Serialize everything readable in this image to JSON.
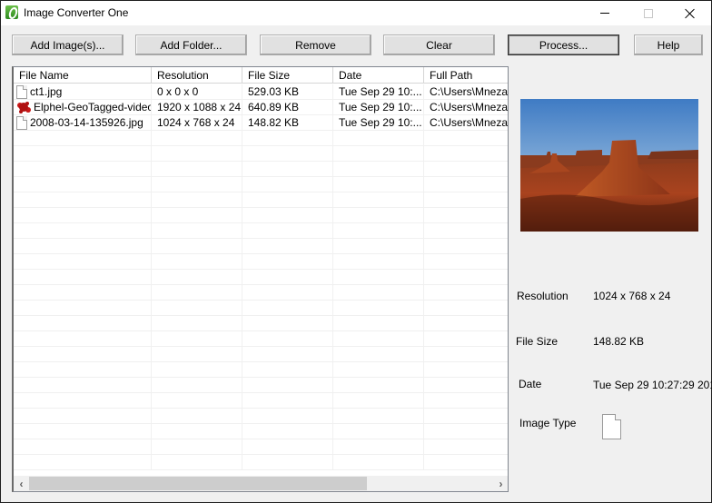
{
  "window": {
    "title": "Image Converter One",
    "controls": {
      "minimize": "minimize-icon",
      "maximize": "maximize-icon",
      "close": "close-icon"
    }
  },
  "toolbar": {
    "add_images": "Add Image(s)...",
    "add_folder": "Add Folder...",
    "remove": "Remove",
    "clear": "Clear",
    "process": "Process...",
    "help": "Help"
  },
  "file_list": {
    "columns": [
      "File Name",
      "Resolution",
      "File Size",
      "Date",
      "Full Path"
    ],
    "rows": [
      {
        "icon": "document-icon",
        "name": "ct1.jpg",
        "resolution": "0 x 0 x 0",
        "size": "529.03 KB",
        "date": "Tue Sep 29 10:...",
        "path": "C:\\Users\\Mnezau\\"
      },
      {
        "icon": "red-splat-icon",
        "name": "Elphel-GeoTagged-video...",
        "resolution": "1920 x 1088 x 24",
        "size": "640.89 KB",
        "date": "Tue Sep 29 10:...",
        "path": "C:\\Users\\Mnezau\\"
      },
      {
        "icon": "document-icon",
        "name": "2008-03-14-135926.jpg",
        "resolution": "1024 x 768 x 24",
        "size": "148.82 KB",
        "date": "Tue Sep 29 10:...",
        "path": "C:\\Users\\Mnezau\\"
      }
    ],
    "scroll": {
      "left": "‹",
      "right": "›",
      "horizontal_position": 0
    }
  },
  "details": {
    "preview_alt": "Desert mesa landscape preview",
    "resolution_label": "Resolution",
    "resolution_value": "1024 x 768 x 24",
    "file_size_label": "File Size",
    "file_size_value": "148.82 KB",
    "date_label": "Date",
    "date_value": "Tue Sep 29 10:27:29 201",
    "image_type_label": "Image Type",
    "image_type_icon": "document-icon"
  }
}
